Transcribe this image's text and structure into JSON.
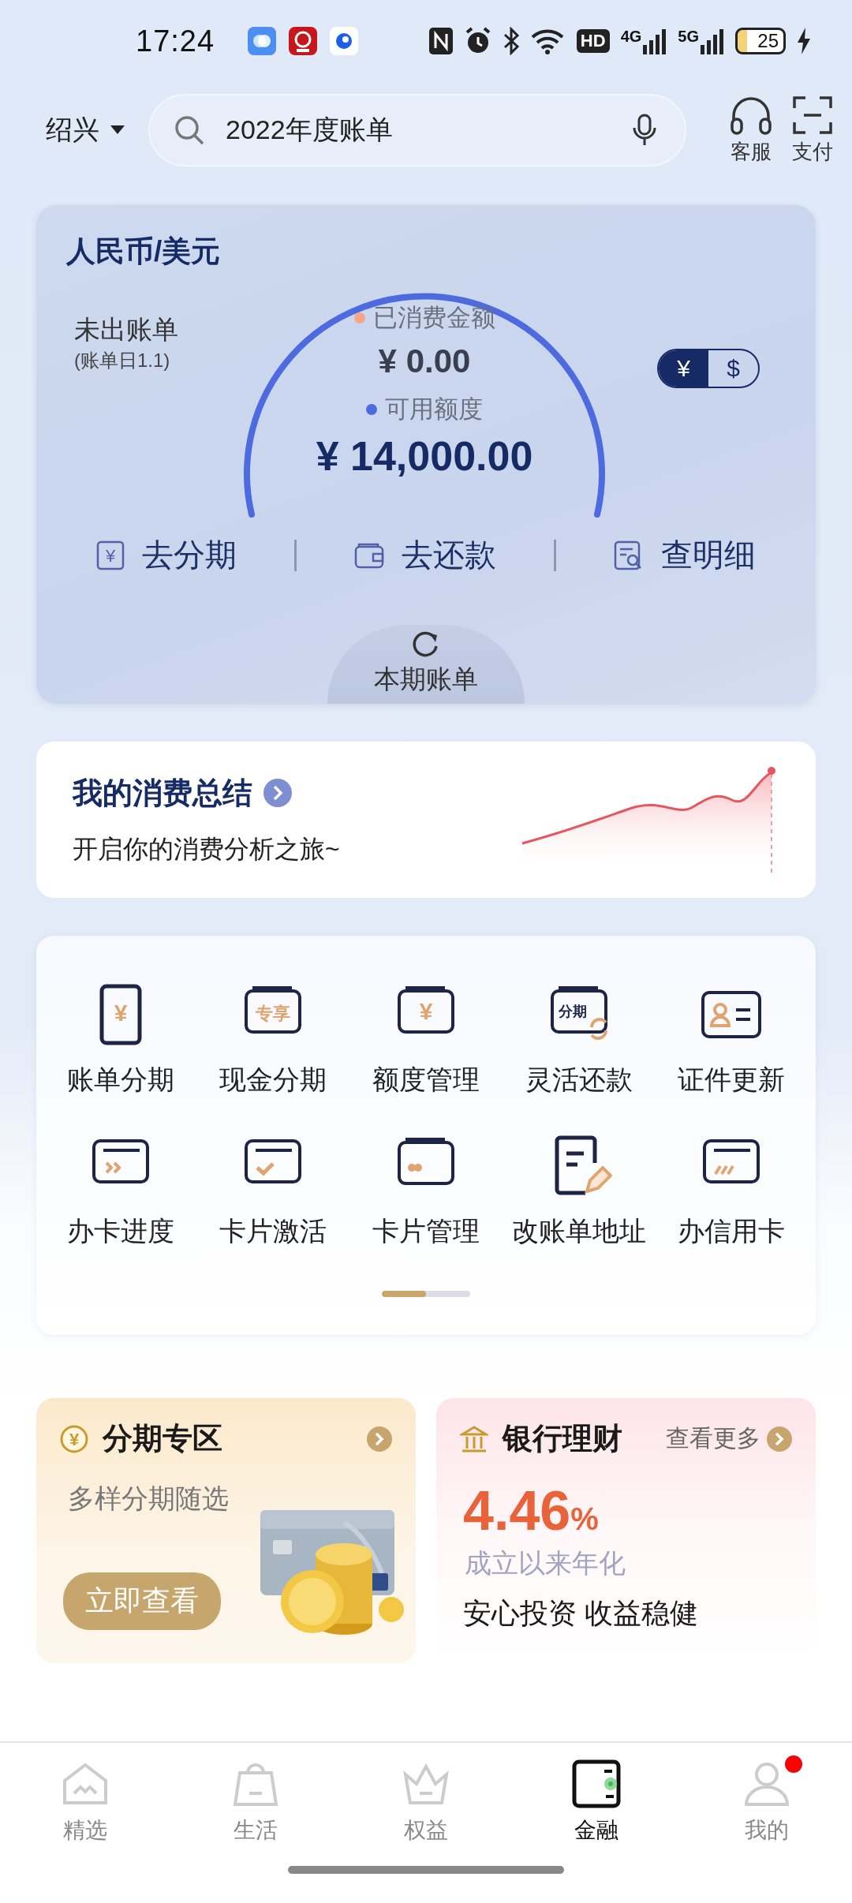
{
  "status_bar": {
    "time": "17:24",
    "network_labels": [
      "4G",
      "5G"
    ],
    "hd_label": "HD",
    "battery": "25"
  },
  "header": {
    "city": "绍兴",
    "search": {
      "value": "2022年度账单"
    },
    "actions": [
      {
        "kind": "headset",
        "label": "客服"
      },
      {
        "kind": "scan",
        "label": "支付"
      }
    ]
  },
  "bill_card": {
    "title": "人民币/美元",
    "status": "未出账单",
    "bill_day": "(账单日1.1)",
    "spent_label": "已消费金额",
    "spent": "¥ 0.00",
    "available_label": "可用额度",
    "available": "¥ 14,000.00",
    "currency_toggle": [
      {
        "label": "¥",
        "selected": true
      },
      {
        "label": "$",
        "selected": false
      }
    ],
    "actions": [
      {
        "kind": "yen",
        "icon_text": "¥",
        "label": "去分期"
      },
      {
        "kind": "wallet",
        "label": "去还款"
      },
      {
        "kind": "detail",
        "label": "查明细"
      }
    ],
    "current_bill": "本期账单"
  },
  "summary": {
    "title": "我的消费总结",
    "subtitle": "开启你的消费分析之旅~"
  },
  "services": {
    "items": [
      {
        "kind": "doc",
        "icon_text": "¥",
        "label": "账单分期"
      },
      {
        "kind": "wallet",
        "icon_text": "专享",
        "label": "现金分期"
      },
      {
        "kind": "wallet",
        "icon_text": "¥",
        "label": "额度管理"
      },
      {
        "kind": "wallet-refresh",
        "icon_text": "分期",
        "label": "灵活还款"
      },
      {
        "kind": "id",
        "label": "证件更新"
      },
      {
        "kind": "card-arrows",
        "label": "办卡进度"
      },
      {
        "kind": "card-check",
        "label": "卡片激活"
      },
      {
        "kind": "card-dots",
        "label": "卡片管理"
      },
      {
        "kind": "doc-pen",
        "label": "改账单地址"
      },
      {
        "kind": "card-stripes",
        "label": "办信用卡"
      }
    ],
    "pager": {
      "level": 0.5
    }
  },
  "promos": [
    {
      "kind": "installment",
      "title": "分期专区",
      "icon_text": "¥",
      "subtitle": "多样分期随选",
      "button": "立即查看"
    },
    {
      "kind": "wealth",
      "title": "银行理财",
      "more": "查看更多",
      "rate": "4.46",
      "rate_unit": "%",
      "rate_label": "成立以来年化",
      "slogan": "安心投资 收益稳健"
    }
  ],
  "bottom_nav": [
    {
      "kind": "home",
      "label": "精选",
      "selected": false,
      "dot": false
    },
    {
      "kind": "bag",
      "label": "生活",
      "selected": false,
      "dot": false
    },
    {
      "kind": "crown",
      "label": "权益",
      "selected": false,
      "dot": false
    },
    {
      "kind": "wallet",
      "label": "金融",
      "selected": true,
      "dot": false
    },
    {
      "kind": "person",
      "label": "我的",
      "selected": false,
      "dot": true
    }
  ]
}
